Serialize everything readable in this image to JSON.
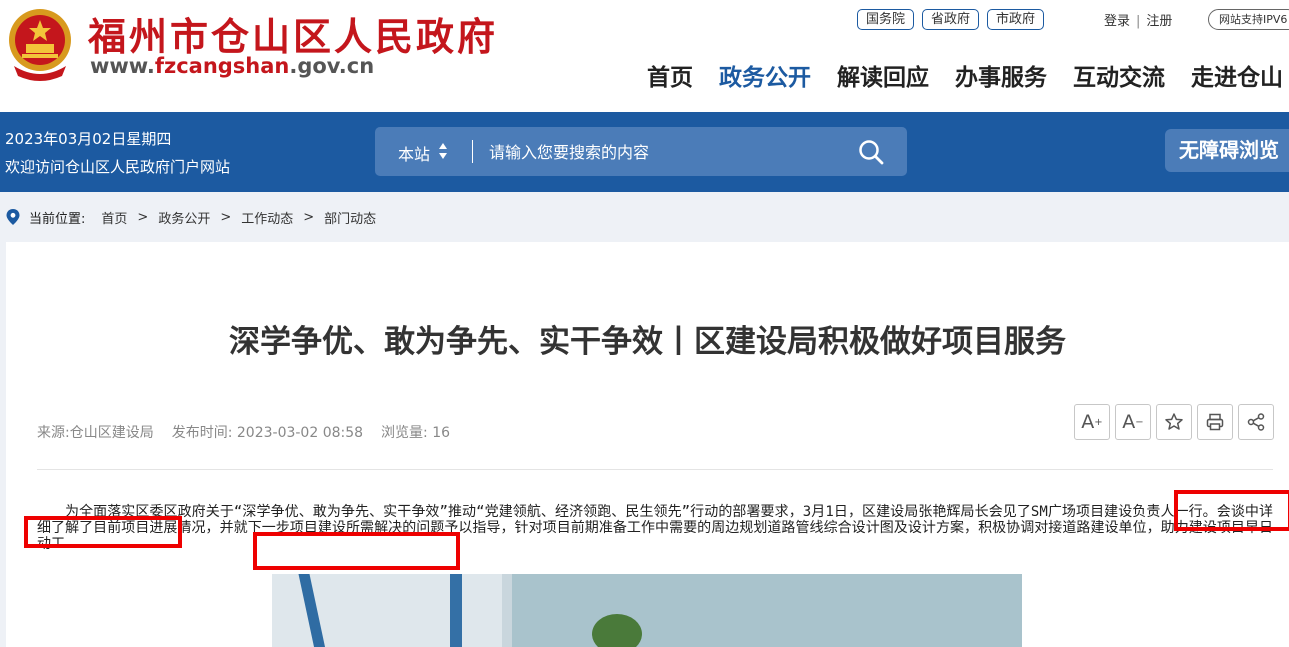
{
  "header": {
    "site_name": "福州市仓山区人民政府",
    "site_domain_prefix": "www.",
    "site_domain_highlight": "fzcangshan",
    "site_domain_suffix": ".gov.cn",
    "top_links": [
      "国务院",
      "省政府",
      "市政府"
    ],
    "login": "登录",
    "auth_sep": "|",
    "register": "注册",
    "ipv6_badge": "网站支持IPV6",
    "nav": [
      "首页",
      "政务公开",
      "解读回应",
      "办事服务",
      "互动交流",
      "走进仓山"
    ],
    "nav_active_index": 1
  },
  "bluebar": {
    "date": "2023年03月02日星期四",
    "welcome": "欢迎访问仓山区人民政府门户网站",
    "search_scope": "本站",
    "search_placeholder": "请输入您要搜索的内容",
    "accessibility": "无障碍浏览"
  },
  "breadcrumb": {
    "label": "当前位置:",
    "items": [
      "首页",
      "政务公开",
      "工作动态",
      "部门动态"
    ],
    "sep": ">"
  },
  "article": {
    "title": "深学争优、敢为争先、实干争效丨区建设局积极做好项目服务",
    "source": "来源:仓山区建设局",
    "publish_time": "发布时间: 2023-03-02 08:58",
    "views": "浏览量: 16",
    "tools": {
      "font_up": "A",
      "font_up_sign": "+",
      "font_down": "A",
      "font_down_sign": "−"
    },
    "paragraph": "为全面落实区委区政府关于“深学争优、敢为争先、实干争效”推动“党建领航、经济领跑、民生领先”行动的部署要求，3月1日，区建设局张艳辉局长会见了SM广场项目建设负责人一行。会谈中详细了解了目前项目进展情况，并就下一步项目建设所需解决的问题予以指导，针对项目前期准备工作中需要的周边规划道路管线综合设计图及设计方案，积极协调对接道路建设单位，助力建设项目早日动工"
  },
  "colors": {
    "brand_red": "#c4161c",
    "brand_blue": "#1c5aa1",
    "search_bg": "#4b7cb8",
    "annotation_red": "#e00000"
  },
  "icons": [
    "national-emblem-icon",
    "sort-arrows-icon",
    "search-icon",
    "location-pin-icon",
    "star-icon",
    "print-icon",
    "share-icon"
  ]
}
